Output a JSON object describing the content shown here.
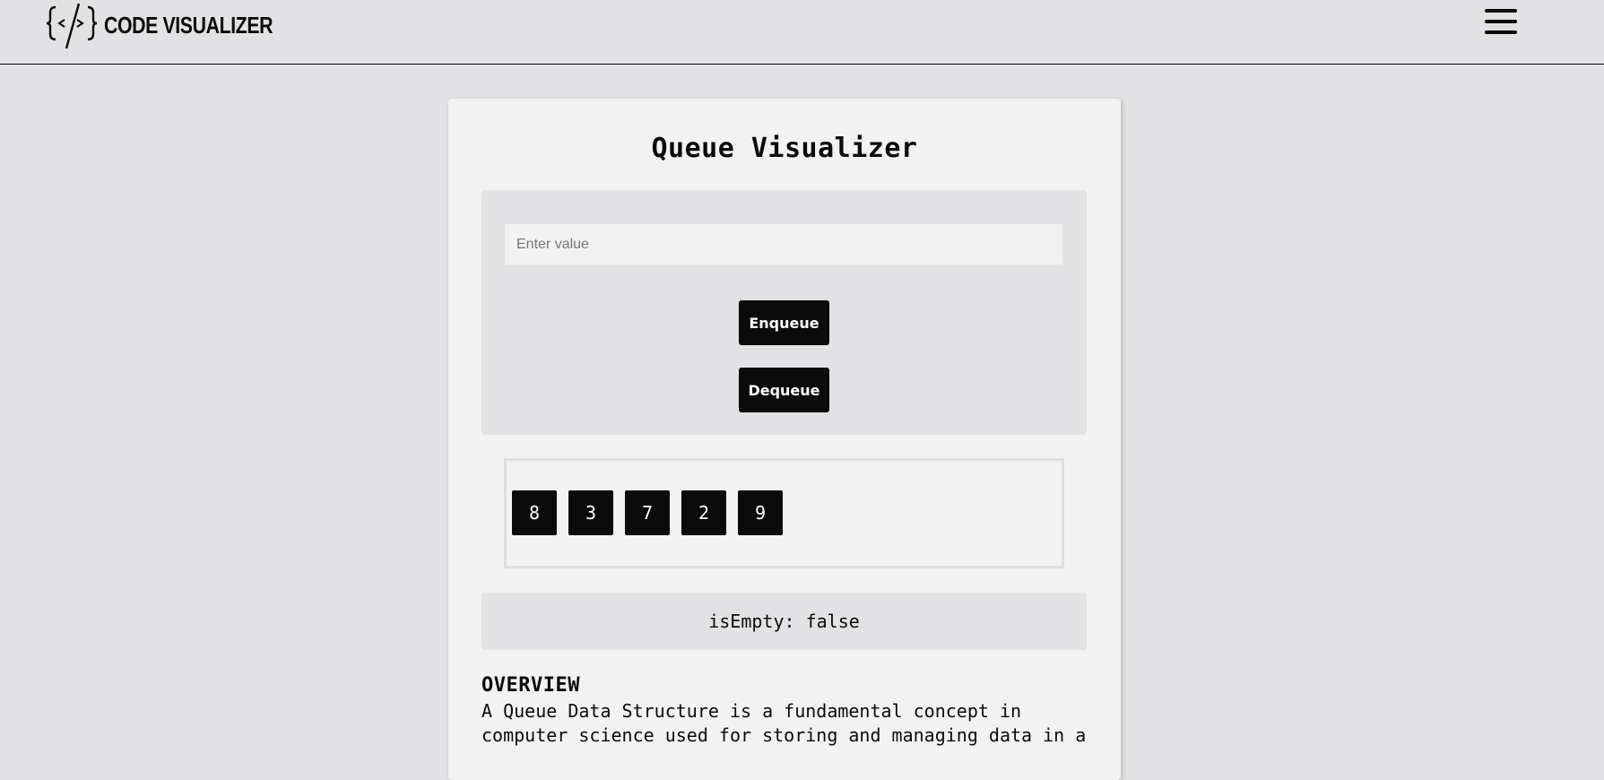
{
  "header": {
    "logo_text": "CODE VISUALIZER",
    "logo_icon": "code-brackets-icon",
    "menu_icon": "hamburger-menu-icon"
  },
  "card": {
    "title": "Queue Visualizer",
    "input": {
      "placeholder": "Enter value",
      "value": ""
    },
    "buttons": {
      "enqueue": "Enqueue",
      "dequeue": "Dequeue"
    },
    "queue_items": [
      "8",
      "3",
      "7",
      "2",
      "9"
    ],
    "status": "isEmpty: false",
    "overview": {
      "heading": "OVERVIEW",
      "text": "A Queue Data Structure is a fundamental concept in\ncomputer science used for storing and managing data in a"
    }
  },
  "colors": {
    "page_background": "#e2e2e4",
    "card_background": "#f2f2f2",
    "accent": "#0b0b0c",
    "button_text": "#ffffff"
  }
}
